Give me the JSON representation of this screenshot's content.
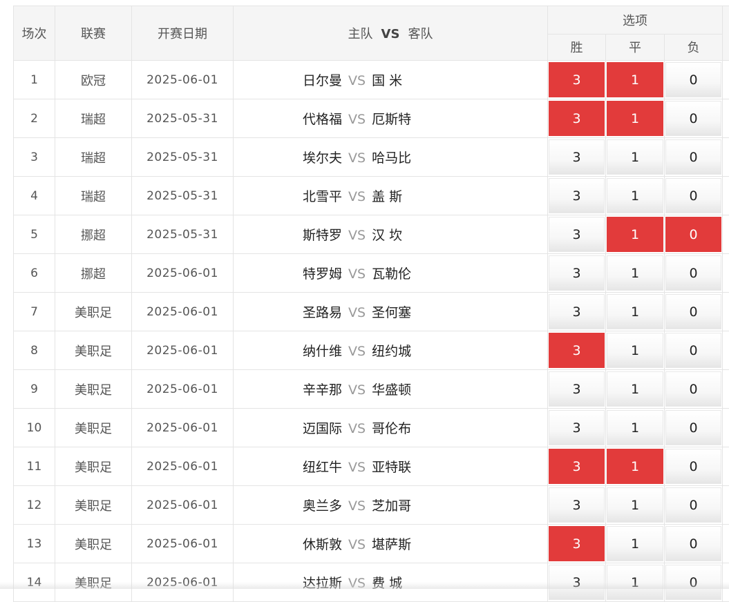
{
  "header": {
    "col_idx": "场次",
    "col_league": "联赛",
    "col_date": "开赛日期",
    "col_home": "主队",
    "col_vs": "VS",
    "col_away": "客队",
    "col_options": "选项",
    "opt_win": "胜",
    "opt_draw": "平",
    "opt_lose": "负"
  },
  "vs_text": "VS",
  "option_values": {
    "win": "3",
    "draw": "1",
    "lose": "0"
  },
  "colors": {
    "selected": "#e23b3b",
    "header_bg": "#f5f5f5"
  },
  "rows": [
    {
      "idx": "1",
      "league": "欧冠",
      "date": "2025-06-01",
      "home": "日尔曼",
      "away": "国 米",
      "sel": {
        "win": true,
        "draw": true,
        "lose": false
      }
    },
    {
      "idx": "2",
      "league": "瑞超",
      "date": "2025-05-31",
      "home": "代格福",
      "away": "厄斯特",
      "sel": {
        "win": true,
        "draw": true,
        "lose": false
      }
    },
    {
      "idx": "3",
      "league": "瑞超",
      "date": "2025-05-31",
      "home": "埃尔夫",
      "away": "哈马比",
      "sel": {
        "win": false,
        "draw": false,
        "lose": false
      }
    },
    {
      "idx": "4",
      "league": "瑞超",
      "date": "2025-05-31",
      "home": "北雪平",
      "away": "盖 斯",
      "sel": {
        "win": false,
        "draw": false,
        "lose": false
      }
    },
    {
      "idx": "5",
      "league": "挪超",
      "date": "2025-05-31",
      "home": "斯特罗",
      "away": "汉 坎",
      "sel": {
        "win": false,
        "draw": true,
        "lose": true
      }
    },
    {
      "idx": "6",
      "league": "挪超",
      "date": "2025-06-01",
      "home": "特罗姆",
      "away": "瓦勒伦",
      "sel": {
        "win": false,
        "draw": false,
        "lose": false
      }
    },
    {
      "idx": "7",
      "league": "美职足",
      "date": "2025-06-01",
      "home": "圣路易",
      "away": "圣何塞",
      "sel": {
        "win": false,
        "draw": false,
        "lose": false
      }
    },
    {
      "idx": "8",
      "league": "美职足",
      "date": "2025-06-01",
      "home": "纳什维",
      "away": "纽约城",
      "sel": {
        "win": true,
        "draw": false,
        "lose": false
      }
    },
    {
      "idx": "9",
      "league": "美职足",
      "date": "2025-06-01",
      "home": "辛辛那",
      "away": "华盛顿",
      "sel": {
        "win": false,
        "draw": false,
        "lose": false
      }
    },
    {
      "idx": "10",
      "league": "美职足",
      "date": "2025-06-01",
      "home": "迈国际",
      "away": "哥伦布",
      "sel": {
        "win": false,
        "draw": false,
        "lose": false
      }
    },
    {
      "idx": "11",
      "league": "美职足",
      "date": "2025-06-01",
      "home": "纽红牛",
      "away": "亚特联",
      "sel": {
        "win": true,
        "draw": true,
        "lose": false
      }
    },
    {
      "idx": "12",
      "league": "美职足",
      "date": "2025-06-01",
      "home": "奥兰多",
      "away": "芝加哥",
      "sel": {
        "win": false,
        "draw": false,
        "lose": false
      }
    },
    {
      "idx": "13",
      "league": "美职足",
      "date": "2025-06-01",
      "home": "休斯敦",
      "away": "堪萨斯",
      "sel": {
        "win": true,
        "draw": false,
        "lose": false
      }
    },
    {
      "idx": "14",
      "league": "美职足",
      "date": "2025-06-01",
      "home": "达拉斯",
      "away": "费 城",
      "sel": {
        "win": false,
        "draw": false,
        "lose": false
      }
    }
  ]
}
